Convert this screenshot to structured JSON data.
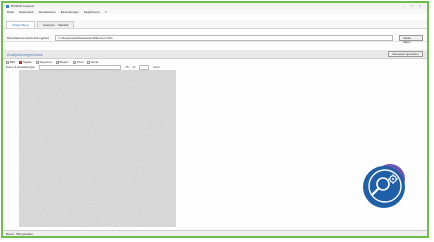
{
  "window": {
    "title": "BIVRAD Analysis",
    "controls": [
      "–",
      "□",
      "×"
    ]
  },
  "menu": [
    "Datei",
    "Datenbank",
    "Aktualisieren",
    "Einstellungen",
    "Registrieren",
    "?"
  ],
  "tabs": [
    {
      "label": "Überprüfung"
    },
    {
      "label": "Analysen · Statistik"
    }
  ],
  "path": {
    "label": "Messdatenverzeichnis/Logpfad:",
    "value": "C:\\Datenbank\\Messdaten\\Wafer\\Lot-042\\",
    "button": "Daten laden"
  },
  "section": {
    "title": "Analysenergebnisse",
    "button": "Messwert speichern"
  },
  "options": [
    {
      "label": "Bild",
      "checked": false
    },
    {
      "label": "Spalte",
      "checked": true
    },
    {
      "label": "Segment",
      "checked": false
    },
    {
      "label": "Beginn",
      "checked": false
    },
    {
      "label": "Pixel",
      "checked": false
    },
    {
      "label": "Ende",
      "checked": false
    }
  ],
  "toolbar": {
    "tool": "Zoom & Einstellungen",
    "value": "75",
    "unit": "%",
    "mode": "Auto"
  },
  "status": "Bereit · Bild geladen",
  "colors": {
    "frame": "#6cc04a",
    "badge": "#1f5fa8",
    "badge_shadow": "#6a55b0",
    "accent": "#5a7fb0"
  },
  "icons": {
    "badge": "magnifier-gear-icon"
  }
}
